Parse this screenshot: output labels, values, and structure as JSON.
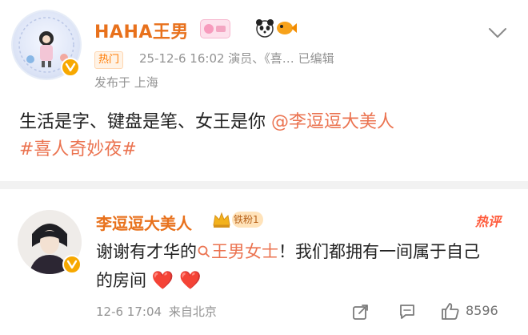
{
  "post": {
    "author": "HAHA王男",
    "hot_tag": "热门",
    "time_source": "25-12-6 16:02  演员、《喜…  已编辑",
    "location": "发布于 上海",
    "content_prefix": "生活是字、键盘是笔、女王是你 ",
    "mention": "@李逗逗大美人",
    "hashtag": "#喜人奇妙夜#"
  },
  "comment": {
    "author": "李逗逗大美人",
    "fan_badge": "铁粉1",
    "hot_label": "热评",
    "text_prefix": "谢谢有才华的",
    "link_text": "王男女士",
    "text_suffix": "！我们都拥有一间属于自己的房间",
    "hearts": "❤️ ❤️",
    "time": "12-6 17:04",
    "source": "来自北京",
    "like_count": "8596"
  },
  "icons": [
    "ellipsis-icon",
    "verified-badge-icon",
    "panda-icon",
    "fish-icon",
    "crown-icon",
    "search-icon",
    "share-icon",
    "comment-icon",
    "like-icon"
  ],
  "colors": {
    "username": "#e8711c",
    "link": "#eb7350",
    "meta": "#939393",
    "hot": "#ff5b3c",
    "badge": "#f7a800"
  }
}
